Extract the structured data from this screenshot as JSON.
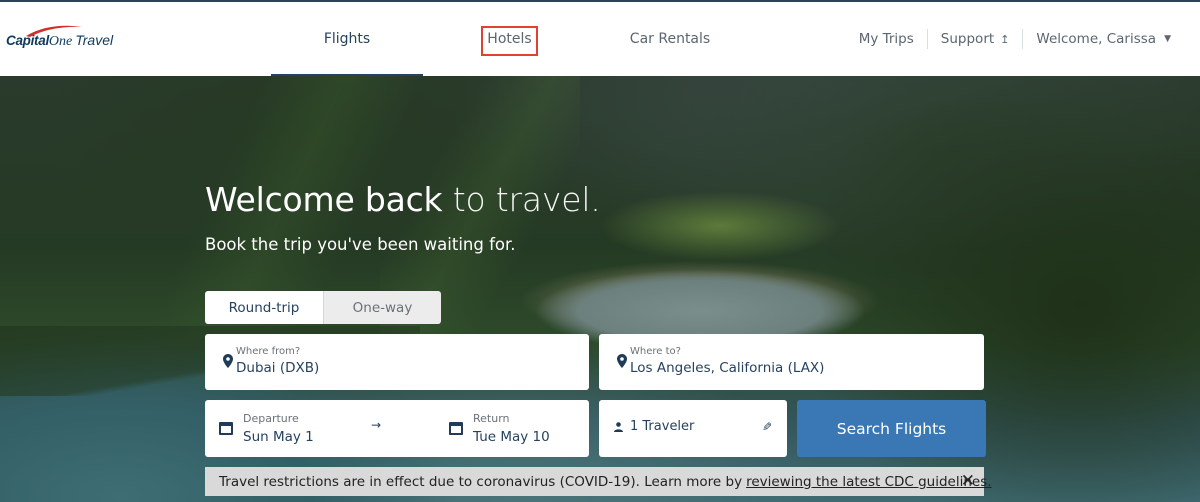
{
  "header": {
    "logo": {
      "brand_bold": "Capital",
      "brand_script": "One",
      "product": "Travel"
    },
    "tabs": [
      {
        "label": "Flights",
        "active": true
      },
      {
        "label": "Hotels",
        "active": false,
        "highlighted": true
      },
      {
        "label": "Car Rentals",
        "active": false
      }
    ],
    "right_links": {
      "my_trips": "My Trips",
      "support": "Support",
      "support_icon": "external-link-icon",
      "welcome": "Welcome, Carissa",
      "welcome_icon": "caret-down-icon"
    }
  },
  "hero": {
    "title_bold": "Welcome back",
    "title_light": " to travel.",
    "subtitle": "Book the trip you've been waiting for."
  },
  "search": {
    "trip_types": [
      {
        "label": "Round-trip",
        "selected": true
      },
      {
        "label": "One-way",
        "selected": false
      }
    ],
    "from": {
      "label": "Where from?",
      "value": "Dubai (DXB)",
      "icon": "map-pin-icon"
    },
    "to": {
      "label": "Where to?",
      "value": "Los Angeles, California (LAX)",
      "icon": "map-pin-icon"
    },
    "departure": {
      "label": "Departure",
      "value": "Sun May 1",
      "icon": "calendar-icon"
    },
    "return": {
      "label": "Return",
      "value": "Tue May 10",
      "icon": "calendar-icon"
    },
    "date_arrow": "→",
    "travelers": {
      "value": "1 Traveler",
      "icon": "person-icon",
      "edit_icon": "pencil-icon"
    },
    "submit_label": "Search Flights"
  },
  "banner": {
    "icon": "bell-icon",
    "text": "Travel restrictions are in effect due to coronavirus (COVID-19). Learn more by",
    "link": "reviewing the latest CDC guidelines.",
    "close": "✕"
  },
  "colors": {
    "brand_navy": "#27425e",
    "search_button": "#3a78b5",
    "highlight_box": "#e2412f",
    "banner_bg": "#d9d9d9"
  }
}
